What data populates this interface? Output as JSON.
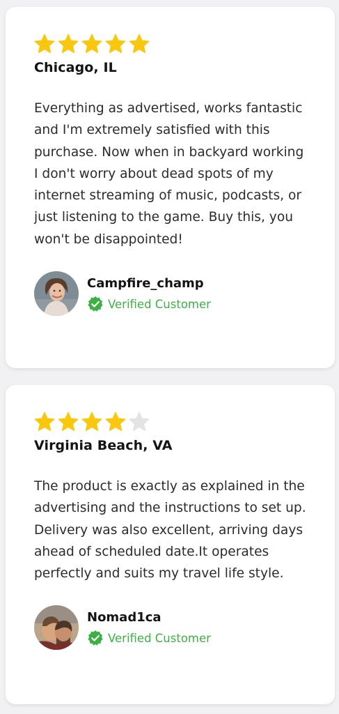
{
  "colors": {
    "star_filled": "#f9c80e",
    "star_empty": "#e3e3e3",
    "verified": "#3cb043",
    "card_background": "#ffffff",
    "page_background": "#f1f1f3"
  },
  "icons": {
    "star": "star-icon",
    "verified": "verified-badge-icon"
  },
  "reviews": [
    {
      "rating": 5,
      "max_rating": 5,
      "location": "Chicago, IL",
      "text": "Everything as advertised, works fantastic and I'm extremely satisfied with this purchase. Now when in backyard working I don't worry about dead spots of my internet streaming of music, podcasts, or just listening to the game. Buy this, you won't be disappointed!",
      "reviewer": "Campfire_champ",
      "verified_label": "Verified Customer"
    },
    {
      "rating": 4,
      "max_rating": 5,
      "location": "Virginia Beach, VA",
      "text": "The product is exactly as explained in the advertising and the instructions to set up. Delivery was also excellent, arriving days ahead of scheduled date.It operates perfectly and suits my travel life style.",
      "reviewer": "Nomad1ca",
      "verified_label": "Verified Customer"
    }
  ]
}
